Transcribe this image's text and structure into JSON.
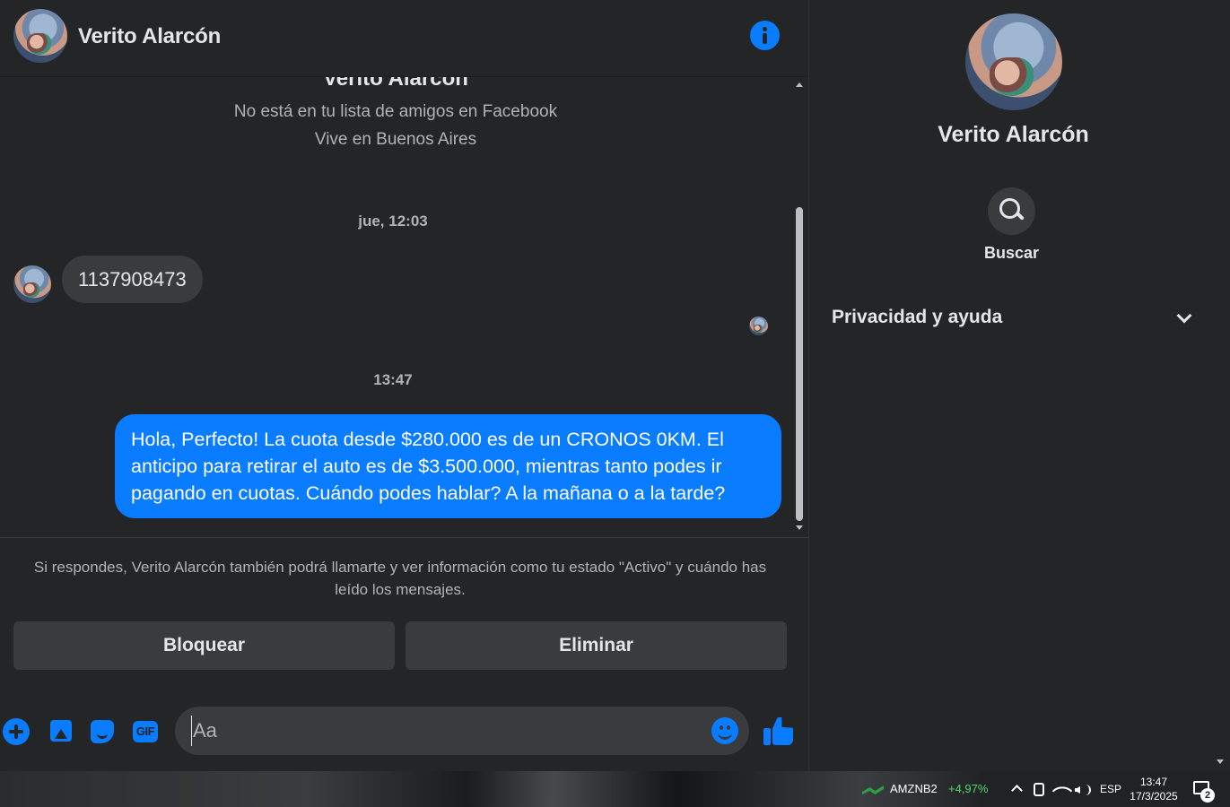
{
  "chat": {
    "header_name": "Verito Alarcón",
    "intro": {
      "name": "Verito Alarcón",
      "friend_status": "No está en tu lista de amigos en Facebook",
      "location": "Vive en Buenos Aires"
    },
    "messages": [
      {
        "timestamp": "jue, 12:03",
        "direction": "incoming",
        "text": "1137908473"
      },
      {
        "timestamp": "13:47",
        "direction": "outgoing",
        "text": "Hola, Perfecto! La cuota desde $280.000 es de un CRONOS 0KM. El anticipo para retirar el auto es de $3.500.000, mientras tanto podes ir pagando en cuotas. Cuándo podes hablar? A la mañana o a la tarde?"
      }
    ],
    "notice": "Si respondes, Verito Alarcón también podrá llamarte y ver información como tu estado \"Activo\" y cuándo has leído los mensajes.",
    "actions": {
      "block": "Bloquear",
      "delete": "Eliminar"
    },
    "composer": {
      "placeholder": "Aa",
      "gif_label": "GIF"
    }
  },
  "panel": {
    "name": "Verito Alarcón",
    "search_label": "Buscar",
    "privacy_label": "Privacidad y ayuda"
  },
  "taskbar": {
    "stock_name": "AMZNB2",
    "stock_change": "+4,97%",
    "language": "ESP",
    "time": "13:47",
    "date": "17/3/2025",
    "notification_count": "2"
  },
  "colors": {
    "accent": "#0a7cff",
    "background": "#242526",
    "bubble_incoming": "#3a3b3c",
    "stock_positive": "#4fd86f"
  }
}
